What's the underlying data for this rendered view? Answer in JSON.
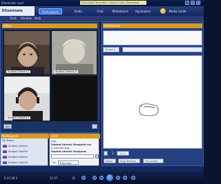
{
  "window": {
    "title": "Elluminate Live!",
    "banner": "Elluminate Recorded | Sample Class (Recorded)",
    "controls": [
      "_",
      "□",
      "×"
    ]
  },
  "nav": {
    "logo": "Elluminate",
    "tabs": [
      "Participants",
      "Audio",
      "Chat",
      "Whiteboard",
      "Application",
      "Media Guide"
    ],
    "active_tab": "Participants"
  },
  "menu": {
    "items": [
      "Tools",
      "Window",
      "Help"
    ]
  },
  "video_panel": {
    "title": "Video",
    "labels": [
      "Student Utrecht 2",
      "Student Utrecht 3",
      "Student Utrecht 4"
    ],
    "talk_button": "Talk"
  },
  "users": {
    "title": "Participants",
    "header": "My Status",
    "rows": [
      "Student Utrecht",
      "Student Utrecht",
      "Student Utrecht",
      "Student Utrecht"
    ]
  },
  "chat": {
    "title": "Chat",
    "lines": [
      "ergo",
      "Student Utrecht: Broepenis ery",
      "e, interniet ergo",
      "Student Utrecht: Broepenis"
    ],
    "to_label": "To:",
    "to_value": "Everyone"
  },
  "whiteboard": {
    "title": "Whiteboard",
    "page_field": "Screen 1",
    "zoom": "1",
    "page_nav": "1 / 1",
    "buttons": [
      "Zoom",
      "Stop Sharing",
      "Full screen"
    ]
  },
  "player": {
    "time_left": "0:11:08.2",
    "time_right": "21:27",
    "speed": "32"
  }
}
